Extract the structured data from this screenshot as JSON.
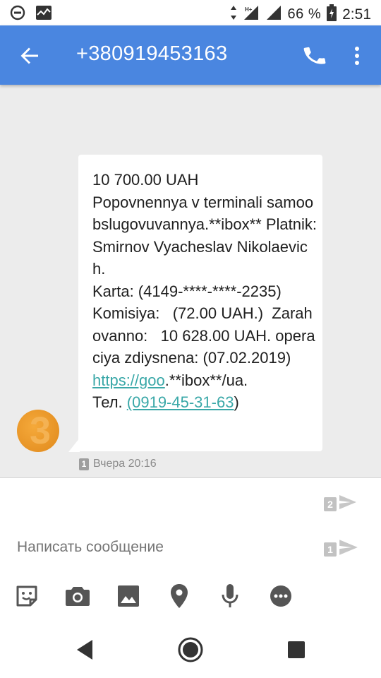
{
  "status_bar": {
    "battery_text": "66 %",
    "time": "2:51",
    "icons": [
      "dnd-icon",
      "activity-icon",
      "data-arrows-icon",
      "signal-icon",
      "signal-icon",
      "battery-icon"
    ]
  },
  "app_bar": {
    "title": "+380919453163",
    "color": "#4a86e0",
    "icons": [
      "back-arrow-icon",
      "phone-icon",
      "more-vert-icon"
    ]
  },
  "message": {
    "body_plain": "10 700.00 UAH\nPopovnennya v terminali samoobslugovuvannya.**ibox** Platnik: Smirnov Vyacheslav Nikolaevich.\nKarta: (4149-****-****-2235)\nKomisiya:   (72.00 UAH.)  Zarahovanno:   10 628.00 UAH. operaciya zdiysnena: (07.02.2019)\n",
    "link_1": "https://goo",
    "middle": ".**ibox**/ua.\nТел. ",
    "link_2": "(0919-45-31-63",
    "end": ")",
    "sim_slot": "1",
    "timestamp": "Вчера 20:16"
  },
  "compose": {
    "placeholder": "Написать сообщение",
    "send_sim_2": "2",
    "send_sim_1": "1",
    "toolbar_icons": [
      "sticker-icon",
      "camera-icon",
      "image-icon",
      "location-icon",
      "mic-icon",
      "more-options-icon"
    ]
  },
  "nav_bar": {
    "icons": [
      "nav-back-icon",
      "nav-home-icon",
      "nav-recents-icon"
    ]
  }
}
